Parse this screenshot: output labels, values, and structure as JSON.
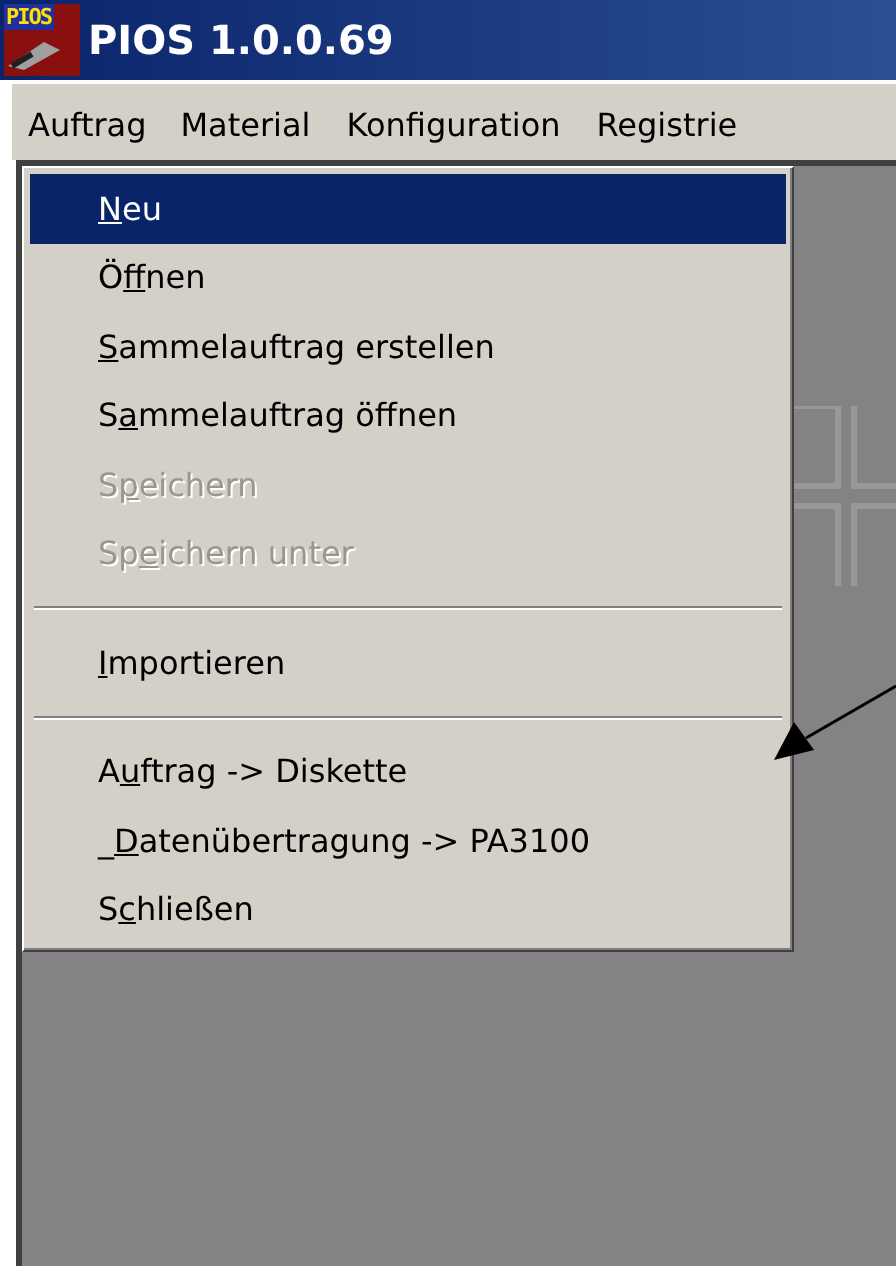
{
  "window": {
    "title": "PIOS 1.0.0.69",
    "logo": "PIOS"
  },
  "menubar": [
    {
      "label": "Auftrag",
      "selected": true
    },
    {
      "label": "Material",
      "selected": false
    },
    {
      "label": "Konfiguration",
      "selected": false
    },
    {
      "label": "Registrie",
      "selected": false
    }
  ],
  "dropdown": [
    {
      "kind": "item",
      "label": {
        "key": "N",
        "after": "eu"
      },
      "selected": true,
      "disabled": false
    },
    {
      "kind": "item",
      "label": {
        "before": "Ö",
        "key": "f",
        "after": "fnen"
      },
      "selected": false,
      "disabled": false
    },
    {
      "kind": "item",
      "label": {
        "key": "S",
        "after": "ammelauftrag erstellen"
      },
      "selected": false,
      "disabled": false
    },
    {
      "kind": "item",
      "label": {
        "before": "S",
        "key": "a",
        "after": "mmelauftrag öffnen"
      },
      "selected": false,
      "disabled": false
    },
    {
      "kind": "item",
      "label": {
        "before": "S",
        "key": "p",
        "after": "eichern"
      },
      "selected": false,
      "disabled": true
    },
    {
      "kind": "item",
      "label": {
        "before": "Sp",
        "key": "e",
        "after": "ichern unter"
      },
      "selected": false,
      "disabled": true
    },
    {
      "kind": "separator"
    },
    {
      "kind": "item",
      "label": {
        "key": "I",
        "after": "mportieren"
      },
      "selected": false,
      "disabled": false
    },
    {
      "kind": "separator"
    },
    {
      "kind": "item",
      "label": {
        "before": "A",
        "key": "u",
        "after": "ftrag -> Diskette"
      },
      "selected": false,
      "disabled": false
    },
    {
      "kind": "item",
      "label": {
        "before": "_",
        "key": "D",
        "after": "atenübertragung -> PA3100"
      },
      "selected": false,
      "disabled": false
    },
    {
      "kind": "item",
      "label": {
        "before": "S",
        "key": "c",
        "after": "hließen"
      },
      "selected": false,
      "disabled": false
    }
  ]
}
